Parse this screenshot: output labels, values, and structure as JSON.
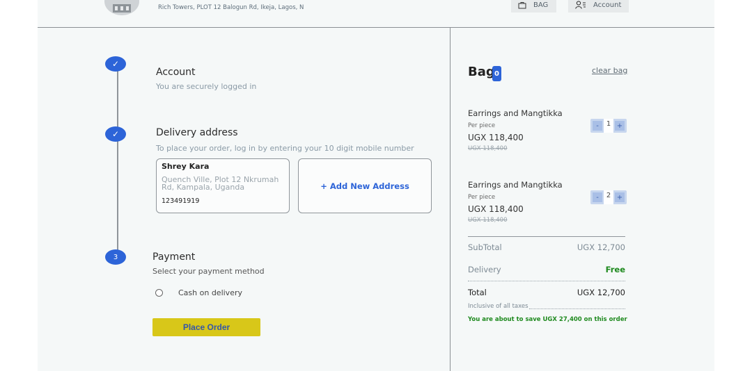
{
  "header": {
    "address": "Rich Towers, PLOT 12 Balogun Rd, Ikeja, Lagos, N",
    "bag_label": "BAG",
    "account_label": "Account"
  },
  "steps": {
    "account": {
      "number": "✓",
      "title": "Account",
      "subtitle": "You are securely logged in"
    },
    "delivery": {
      "number": "✓",
      "title": "Delivery address",
      "subtitle": "To place your order, log in by entering your 10 digit mobile number",
      "saved_address": {
        "name": "Shrey Kara",
        "line": "Quench Ville, Plot 12 Nkrumah Rd, Kampala, Uganda",
        "phone": "123491919"
      },
      "add_new_label": "+ Add New Address"
    },
    "payment": {
      "number": "3",
      "title": "Payment",
      "subtitle": "Select your payment method",
      "method": "Cash on delivery",
      "place_order_label": "Place Order"
    }
  },
  "bag": {
    "title": "Bag",
    "count": "0",
    "clear_label": "clear bag",
    "items": [
      {
        "name": "Earrings and Mangtikka",
        "unit": "Per piece",
        "price": "UGX 118,400",
        "old_price": "UGX 118,400",
        "qty": "1"
      },
      {
        "name": "Earrings and Mangtikka",
        "unit": "Per piece",
        "price": "UGX 118,400",
        "old_price": "UGX 118,400",
        "qty": "2"
      }
    ],
    "stepper": {
      "minus": "-",
      "plus": "+"
    },
    "subtotal_label": "SubTotal",
    "subtotal_value": "UGX 12,700",
    "delivery_label": "Delivery",
    "delivery_value": "Free",
    "total_label": "Total",
    "total_value": "UGX 12,700",
    "inclusive_note": "Inclusive of all taxes",
    "savings_note": "You are about to save UGX 27,400 on this order"
  },
  "colors": {
    "accent": "#2d64d8",
    "place_order_bg": "#d8c719",
    "success": "#1f8a1f"
  }
}
